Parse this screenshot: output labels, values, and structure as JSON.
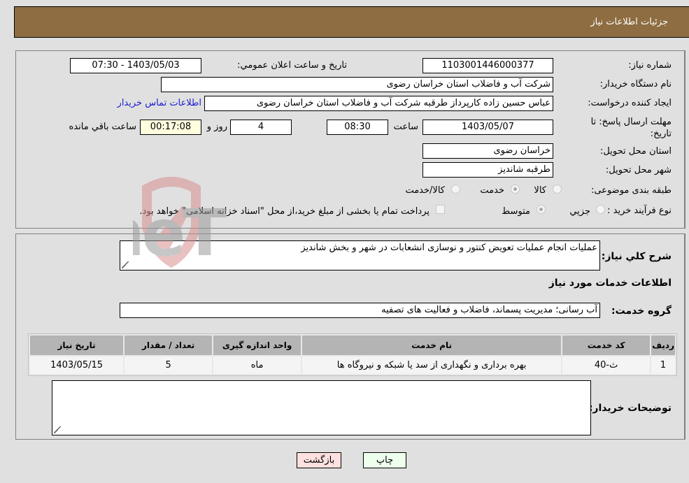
{
  "header": {
    "title": "جزئیات اطلاعات نیاز"
  },
  "details": {
    "need_number": {
      "label": "شماره نیاز:",
      "value": "1103001446000377"
    },
    "announce": {
      "label": "تاریخ و ساعت اعلان عمومي:",
      "value": "1403/05/03 - 07:30"
    },
    "buyer_org": {
      "label": "نام دستگاه خریدار:",
      "value": "شرکت آب و فاضلاب استان خراسان رضوی"
    },
    "creator": {
      "label": "ایجاد کننده درخواست:",
      "value": "عباس حسین زاده کارپرداز طرقبه  شرکت آب و فاضلاب استان خراسان رضوی",
      "contact_link": "اطلاعات تماس خریدار"
    },
    "deadline": {
      "label": "مهلت ارسال پاسخ: تا تاریخ:",
      "date": "1403/05/07",
      "time_label": "ساعت",
      "time": "08:30",
      "days": "4",
      "days_label": "روز و",
      "remaining": "00:17:08",
      "remaining_label": "ساعت باقي مانده"
    },
    "province": {
      "label": "استان محل تحویل:",
      "value": "خراسان رضوی"
    },
    "city": {
      "label": "شهر محل تحویل:",
      "value": "طرقبه شاندیز"
    },
    "category": {
      "label": "طبقه بندی موضوعی:",
      "options": [
        {
          "label": "کالا",
          "checked": false
        },
        {
          "label": "خدمت",
          "checked": true
        },
        {
          "label": "کالا/خدمت",
          "checked": false
        }
      ]
    },
    "process": {
      "label": "نوع فرآیند خرید :",
      "options": [
        {
          "label": "جزیي",
          "checked": false
        },
        {
          "label": "متوسط",
          "checked": true
        }
      ],
      "payment_note": "پرداخت تمام یا بخشی از مبلغ خرید،از محل \"اسناد خزانه اسلامی\" خواهد بود."
    }
  },
  "description": {
    "label": "شرح کلي نیاز:",
    "value": "عملیات انجام عملیات تعویض کنتور و نوسازی انشعابات در شهر و بخش شاندیز"
  },
  "services": {
    "section_title": "اطلاعات خدمات مورد نیاز",
    "group_label": "گروه خدمت:",
    "group_value": "آب رسانی؛ مدیریت پسماند، فاضلاب و فعالیت های تصفیه",
    "table": {
      "headers": [
        "ردیف",
        "کد خدمت",
        "نام خدمت",
        "واحد اندازه گیری",
        "تعداد / مقدار",
        "تاریخ نیاز"
      ],
      "rows": [
        [
          "1",
          "ث-40",
          "بهره برداری و نگهداری از سد یا شبکه و نیروگاه ها",
          "ماه",
          "5",
          "1403/05/15"
        ]
      ]
    }
  },
  "buyer_notes": {
    "label": "توضیحات خریدار:",
    "value": ""
  },
  "buttons": {
    "print": "چاپ",
    "back": "بازگشت"
  },
  "watermark": {
    "text": "AriaTender.neT"
  },
  "colors": {
    "header_bg": "#8e6d42",
    "link": "#1a1ad0",
    "print_bg": "#eeffee",
    "back_bg": "#ffe0e0"
  }
}
